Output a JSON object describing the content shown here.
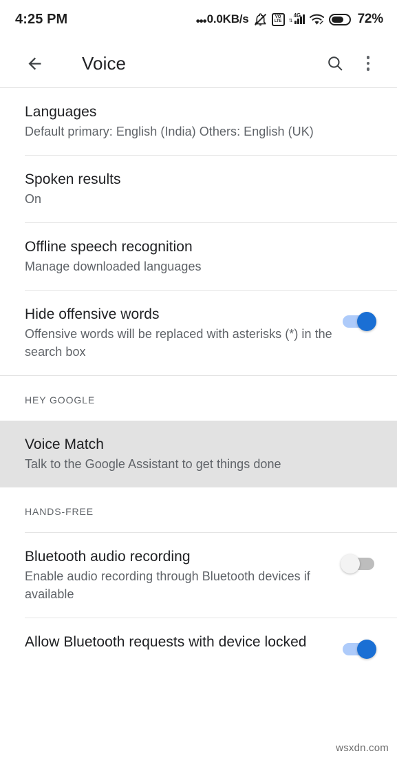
{
  "status_bar": {
    "time": "4:25 PM",
    "network_speed": "0.0KB/s",
    "dots": "•••",
    "volte_top": "VO",
    "volte_bottom": "LTE",
    "network_type": "4G",
    "data_arrows": "⇅",
    "battery_percent": "72%",
    "icons": [
      "three-dots-icon",
      "silent-bell-icon",
      "volte-icon",
      "signal-bars-icon",
      "wifi-icon",
      "battery-icon"
    ]
  },
  "app_bar": {
    "back_icon": "back-arrow-icon",
    "title": "Voice",
    "search_icon": "search-icon",
    "overflow_icon": "overflow-menu-icon"
  },
  "settings": [
    {
      "name": "languages",
      "title": "Languages",
      "subtitle": "Default primary: English (India) Others: English (UK)",
      "toggle": null,
      "highlight": false
    },
    {
      "name": "spoken-results",
      "title": "Spoken results",
      "subtitle": "On",
      "toggle": null,
      "highlight": false
    },
    {
      "name": "offline-speech-recognition",
      "title": "Offline speech recognition",
      "subtitle": "Manage downloaded languages",
      "toggle": null,
      "highlight": false
    },
    {
      "name": "hide-offensive-words",
      "title": "Hide offensive words",
      "subtitle": "Offensive words will be replaced with asterisks (*) in the search box",
      "toggle": "on",
      "highlight": false
    }
  ],
  "sections": [
    {
      "name": "hey-google",
      "header": "HEY GOOGLE",
      "rows": [
        {
          "name": "voice-match",
          "title": "Voice Match",
          "subtitle": "Talk to the Google Assistant to get things done",
          "toggle": null,
          "highlight": true
        }
      ]
    },
    {
      "name": "hands-free",
      "header": "HANDS-FREE",
      "rows": [
        {
          "name": "bluetooth-audio-recording",
          "title": "Bluetooth audio recording",
          "subtitle": "Enable audio recording through Bluetooth devices if available",
          "toggle": "off",
          "highlight": false
        },
        {
          "name": "allow-bluetooth-requests-with-device-locked",
          "title": "Allow Bluetooth requests with device locked",
          "subtitle": "",
          "toggle": "on",
          "highlight": false
        }
      ]
    }
  ],
  "colors": {
    "toggle_on_thumb": "#1a6fd4",
    "toggle_on_track": "#aecbfa",
    "toggle_off_thumb": "#f3f3f3",
    "toggle_off_track": "#bdbdbd",
    "highlight_bg": "#e2e2e2",
    "title_text": "#202124",
    "subtitle_text": "#5f6368"
  },
  "watermark": "wsxdn.com"
}
